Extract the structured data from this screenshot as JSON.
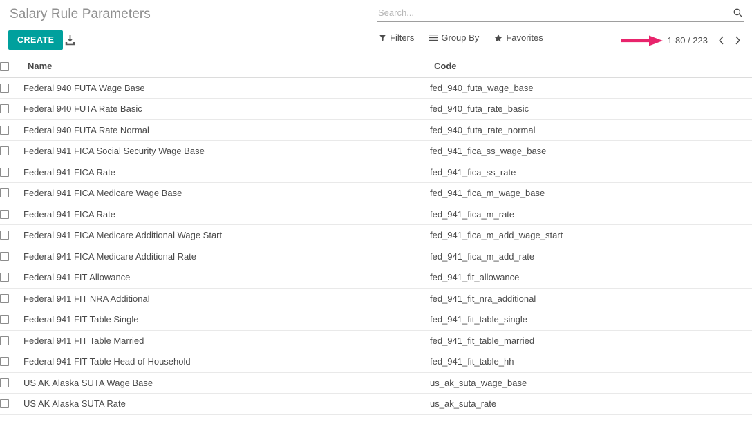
{
  "header": {
    "title": "Salary Rule Parameters",
    "create_label": "CREATE",
    "import_icon": "download-icon"
  },
  "search": {
    "placeholder": "Search...",
    "value": "",
    "icon": "search-icon"
  },
  "toolbar": {
    "filters_label": "Filters",
    "filters_icon": "funnel-icon",
    "group_by_label": "Group By",
    "group_by_icon": "list-lines-icon",
    "favorites_label": "Favorites",
    "favorites_icon": "star-icon"
  },
  "pager": {
    "range": "1-80 / 223",
    "prev_icon": "chevron-left-icon",
    "next_icon": "chevron-right-icon"
  },
  "annotation": {
    "arrow_color": "#E8246C",
    "arrow_direction": "right",
    "points_to": "pager-range"
  },
  "colors": {
    "accent": "#00A09D",
    "title": "#8F8F8F",
    "text": "#4A4A4A",
    "row_border": "#E9E9E9"
  },
  "table": {
    "columns": [
      {
        "key": "name",
        "label": "Name"
      },
      {
        "key": "code",
        "label": "Code"
      }
    ],
    "rows": [
      {
        "name": "Federal 940 FUTA Wage Base",
        "code": "fed_940_futa_wage_base"
      },
      {
        "name": "Federal 940 FUTA Rate Basic",
        "code": "fed_940_futa_rate_basic"
      },
      {
        "name": "Federal 940 FUTA Rate Normal",
        "code": "fed_940_futa_rate_normal"
      },
      {
        "name": "Federal 941 FICA Social Security Wage Base",
        "code": "fed_941_fica_ss_wage_base"
      },
      {
        "name": "Federal 941 FICA Rate",
        "code": "fed_941_fica_ss_rate"
      },
      {
        "name": "Federal 941 FICA Medicare Wage Base",
        "code": "fed_941_fica_m_wage_base"
      },
      {
        "name": "Federal 941 FICA Rate",
        "code": "fed_941_fica_m_rate"
      },
      {
        "name": "Federal 941 FICA Medicare Additional Wage Start",
        "code": "fed_941_fica_m_add_wage_start"
      },
      {
        "name": "Federal 941 FICA Medicare Additional Rate",
        "code": "fed_941_fica_m_add_rate"
      },
      {
        "name": "Federal 941 FIT Allowance",
        "code": "fed_941_fit_allowance"
      },
      {
        "name": "Federal 941 FIT NRA Additional",
        "code": "fed_941_fit_nra_additional"
      },
      {
        "name": "Federal 941 FIT Table Single",
        "code": "fed_941_fit_table_single"
      },
      {
        "name": "Federal 941 FIT Table Married",
        "code": "fed_941_fit_table_married"
      },
      {
        "name": "Federal 941 FIT Table Head of Household",
        "code": "fed_941_fit_table_hh"
      },
      {
        "name": "US AK Alaska SUTA Wage Base",
        "code": "us_ak_suta_wage_base"
      },
      {
        "name": "US AK Alaska SUTA Rate",
        "code": "us_ak_suta_rate"
      }
    ]
  }
}
